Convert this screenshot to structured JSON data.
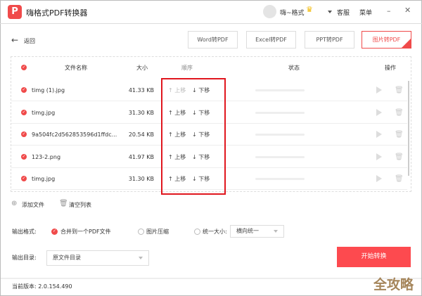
{
  "app": {
    "title": "嗨格式PDF转换器",
    "logo_text": "P",
    "user": "嗨~格式",
    "service": "客服",
    "menu": "菜单"
  },
  "nav": {
    "back": "返回",
    "tabs": [
      {
        "label": "Word转PDF"
      },
      {
        "label": "Excel转PDF"
      },
      {
        "label": "PPT转PDF"
      },
      {
        "label": "图片转PDF",
        "active": true
      }
    ]
  },
  "table": {
    "headers": {
      "name": "文件名称",
      "size": "大小",
      "order": "顺序",
      "status": "状态",
      "actions": "操作"
    },
    "rows": [
      {
        "name": "timg (1).jpg",
        "size": "41.33 KB",
        "up": "上移",
        "down": "下移",
        "up_disabled": true
      },
      {
        "name": "timg.jpg",
        "size": "31.30 KB",
        "up": "上移",
        "down": "下移"
      },
      {
        "name": "9a504fc2d562853596d1ffdc...",
        "size": "20.54 KB",
        "up": "上移",
        "down": "下移"
      },
      {
        "name": "123-2.png",
        "size": "41.97 KB",
        "up": "上移",
        "down": "下移"
      },
      {
        "name": "timg.jpg",
        "size": "31.30 KB",
        "up": "上移",
        "down": "下移"
      }
    ]
  },
  "list_actions": {
    "add": "添加文件",
    "clear": "清空列表"
  },
  "output": {
    "format_label": "输出格式:",
    "opt_merge": "合并到一个PDF文件",
    "opt_compress": "图片压缩",
    "opt_unify": "统一大小:",
    "unify_value": "横向统一",
    "dir_label": "输出目录:",
    "dir_value": "原文件目录",
    "start": "开始转换"
  },
  "footer": {
    "version": "当前版本: 2.0.154.490"
  },
  "watermark": "全攻略",
  "colors": {
    "accent": "#f04a4a",
    "highlight": "#e0161e"
  }
}
